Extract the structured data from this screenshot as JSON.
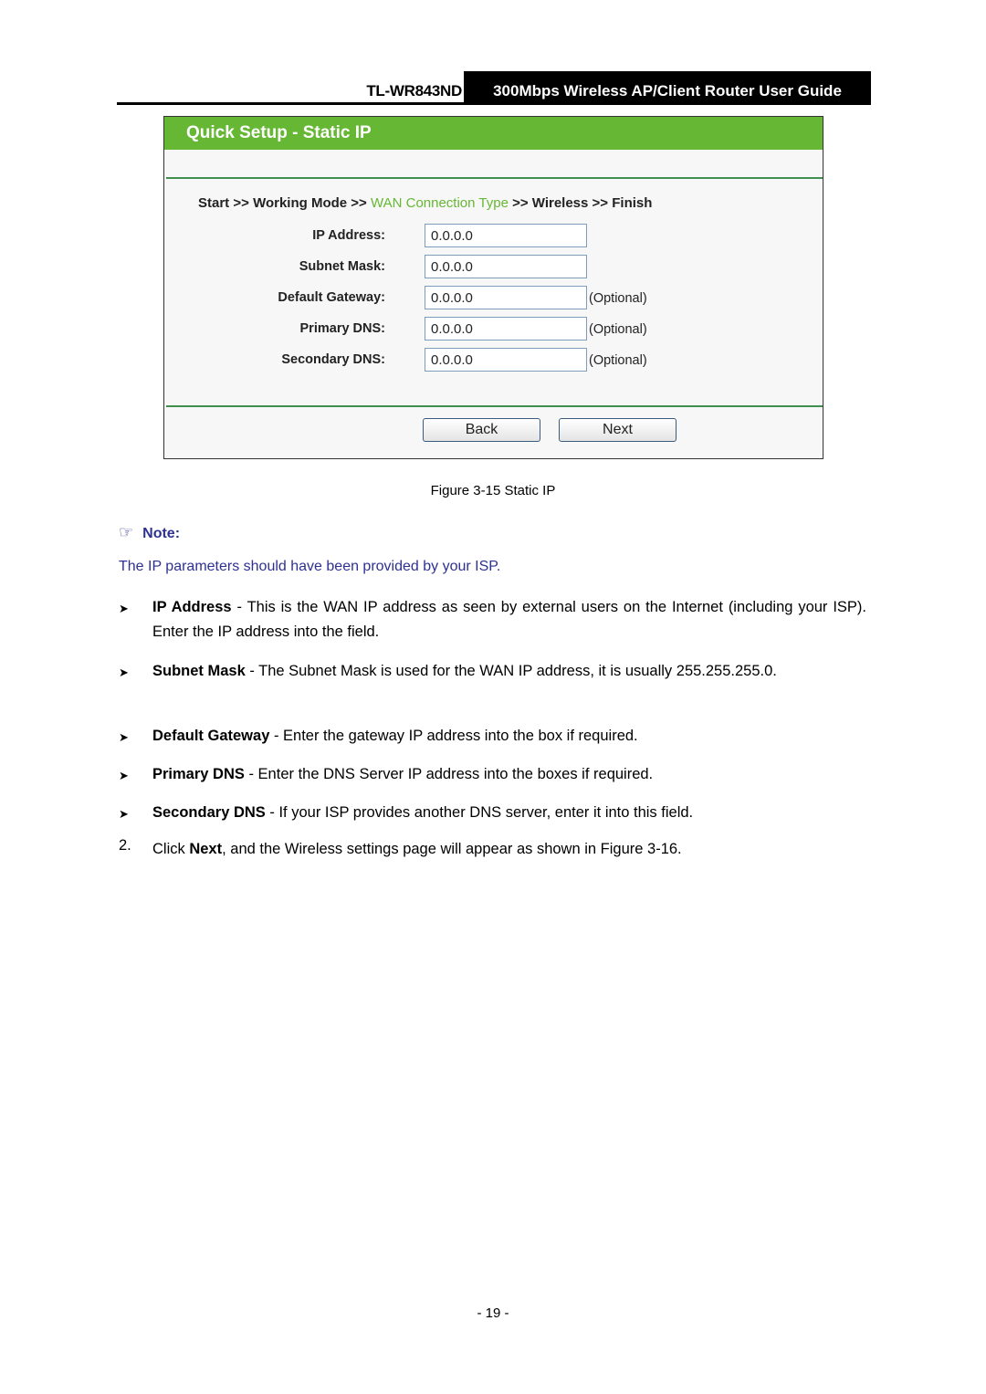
{
  "header": {
    "model": "TL-WR843ND",
    "title": "300Mbps Wireless AP/Client Router User Guide"
  },
  "screenshot": {
    "title": "Quick Setup - Static IP",
    "breadcrumb": {
      "items": [
        "Start",
        "Working Mode",
        "WAN Connection Type",
        "Wireless",
        "Finish"
      ],
      "separator": ">>",
      "active_index": 2
    },
    "fields": [
      {
        "label": "IP Address:",
        "value": "0.0.0.0",
        "note": ""
      },
      {
        "label": "Subnet Mask:",
        "value": "0.0.0.0",
        "note": ""
      },
      {
        "label": "Default Gateway:",
        "value": "0.0.0.0",
        "note": "(Optional)"
      },
      {
        "label": "Primary DNS:",
        "value": "0.0.0.0",
        "note": "(Optional)"
      },
      {
        "label": "Secondary DNS:",
        "value": "0.0.0.0",
        "note": "(Optional)"
      }
    ],
    "back_label": "Back",
    "next_label": "Next",
    "accent_color": "#66b734"
  },
  "caption": "Figure 3-15 Static IP",
  "note": {
    "icon": "pointing-hand-icon",
    "heading": "Note:",
    "text": "The IP parameters should have been provided by your ISP.",
    "color": "#2e3192"
  },
  "bullets": [
    {
      "term": "IP Address",
      "text": " - This is the WAN IP address as seen by external users on the Internet (including your ISP). Enter the IP address into the field."
    },
    {
      "term": "Subnet Mask",
      "text": " - The Subnet Mask is used for the WAN IP address, it is usually 255.255.255.0."
    },
    {
      "term": "Default Gateway",
      "text": " - Enter the gateway IP address into the box if required."
    },
    {
      "term": "Primary DNS",
      "text": " - Enter the DNS Server IP address into the boxes if required."
    },
    {
      "term": "Secondary DNS",
      "text": " - If your ISP provides another DNS server, enter it into this field."
    }
  ],
  "step": {
    "number": "2.",
    "pre": "Click ",
    "bold": "Next",
    "post": ", and the Wireless settings page will appear as shown in Figure 3-16."
  },
  "page_number": "- 19 -"
}
